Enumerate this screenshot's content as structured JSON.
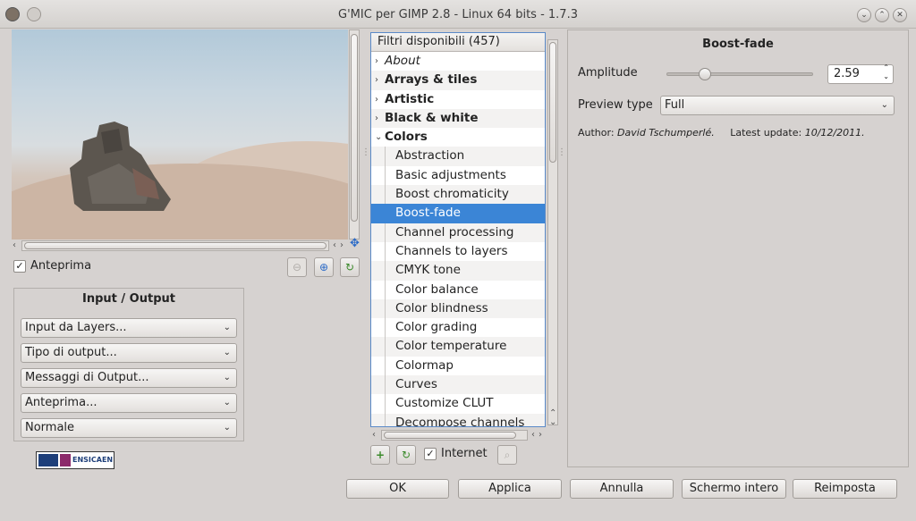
{
  "window": {
    "title": "G'MIC per GIMP 2.8 - Linux 64 bits - 1.7.3",
    "buttons": {
      "minimize": "⌄",
      "maximize": "⌃",
      "close": "✕"
    }
  },
  "preview": {
    "enabled_label": "Anteprima",
    "enabled": true,
    "zoom_out_icon": "zoom-out-icon",
    "zoom_in_icon": "zoom-in-icon",
    "refresh_icon": "refresh-icon"
  },
  "io": {
    "title": "Input / Output",
    "input": "Input da Layers...",
    "output": "Tipo di output...",
    "messages": "Messaggi di Output...",
    "preview_mode": "Anteprima...",
    "blend": "Normale"
  },
  "logo": {
    "text": "ENSICAEN"
  },
  "filters": {
    "header": "Filtri disponibili (457)",
    "items": [
      {
        "label": "About",
        "level": 0,
        "style": "italic",
        "expander": "›"
      },
      {
        "label": "Arrays & tiles",
        "level": 0,
        "style": "bold",
        "expander": "›"
      },
      {
        "label": "Artistic",
        "level": 0,
        "style": "bold",
        "expander": "›"
      },
      {
        "label": "Black & white",
        "level": 0,
        "style": "bold",
        "expander": "›"
      },
      {
        "label": "Colors",
        "level": 0,
        "style": "bold",
        "expander": "⌄"
      },
      {
        "label": "Abstraction",
        "level": 1
      },
      {
        "label": "Basic adjustments",
        "level": 1
      },
      {
        "label": "Boost chromaticity",
        "level": 1
      },
      {
        "label": "Boost-fade",
        "level": 1,
        "selected": true
      },
      {
        "label": "Channel processing",
        "level": 1
      },
      {
        "label": "Channels to layers",
        "level": 1
      },
      {
        "label": "CMYK tone",
        "level": 1
      },
      {
        "label": "Color balance",
        "level": 1
      },
      {
        "label": "Color blindness",
        "level": 1
      },
      {
        "label": "Color grading",
        "level": 1
      },
      {
        "label": "Color temperature",
        "level": 1
      },
      {
        "label": "Colormap",
        "level": 1
      },
      {
        "label": "Curves",
        "level": 1
      },
      {
        "label": "Customize CLUT",
        "level": 1
      },
      {
        "label": "Decompose channels",
        "level": 1
      }
    ],
    "internet_label": "Internet",
    "internet_checked": true
  },
  "filter_settings": {
    "title": "Boost-fade",
    "amplitude_label": "Amplitude",
    "amplitude_value": "2.59",
    "amplitude_fraction": 0.26,
    "preview_type_label": "Preview type",
    "preview_type_value": "Full",
    "author_label": "Author:",
    "author_name": "David Tschumperlé.",
    "update_label": "Latest update:",
    "update_date": "10/12/2011."
  },
  "actions": {
    "ok": "OK",
    "apply": "Applica",
    "cancel": "Annulla",
    "fullscreen": "Schermo intero",
    "reset": "Reimposta"
  }
}
